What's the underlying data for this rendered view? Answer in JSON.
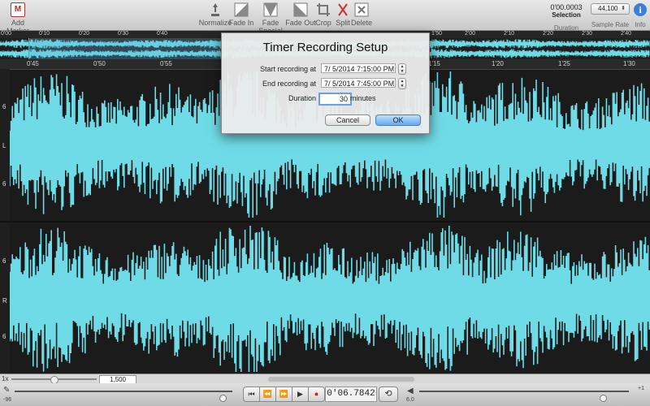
{
  "toolbar": {
    "add_marker": "Add Marker",
    "tools": [
      {
        "label": "Normalize",
        "icon": "normalize-icon"
      },
      {
        "label": "Fade In",
        "icon": "fade-in-icon"
      },
      {
        "label": "Fade Special",
        "icon": "fade-special-icon"
      },
      {
        "label": "Fade Out",
        "icon": "fade-out-icon"
      },
      {
        "label": "Crop",
        "icon": "crop-icon"
      },
      {
        "label": "Split",
        "icon": "split-icon"
      },
      {
        "label": "Delete",
        "icon": "delete-icon"
      }
    ],
    "selection_value": "0'00.0003",
    "selection_label": "Selection",
    "duration_label": "Duration",
    "sample_rate_value": "44,100",
    "sample_rate_label": "Sample Rate",
    "info_label": "Info"
  },
  "overview_ruler": [
    "0'00",
    "0'10",
    "0'20",
    "0'30",
    "0'40",
    "1'50",
    "2'00",
    "2'10",
    "2'20",
    "2'30",
    "2'40"
  ],
  "main_ruler": [
    "0'45",
    "0'50",
    "0'55",
    "1'15",
    "1'20",
    "1'25",
    "1'30"
  ],
  "channels": {
    "left_label": "L",
    "right_label": "R",
    "scale_label": "6"
  },
  "colors": {
    "waveform": "#6fdbe6",
    "background": "#1b1b1b",
    "accent": "#3b7ed8",
    "record": "#d32020"
  },
  "dialog": {
    "title": "Timer Recording Setup",
    "start_label": "Start recording at",
    "start_value": "7/  5/2014   7:15:00  PM",
    "end_label": "End recording at",
    "end_value": "7/  5/2014   7:45:00  PM",
    "duration_label": "Duration",
    "duration_value": "30",
    "duration_unit": "minutes",
    "cancel_label": "Cancel",
    "ok_label": "OK"
  },
  "status": {
    "zoom_label": "1x",
    "zoom_field": "1,500"
  },
  "transport": {
    "time": "0'06.7842",
    "volume_left": "-96",
    "volume_right": "6.0",
    "plus_label": "+1"
  }
}
